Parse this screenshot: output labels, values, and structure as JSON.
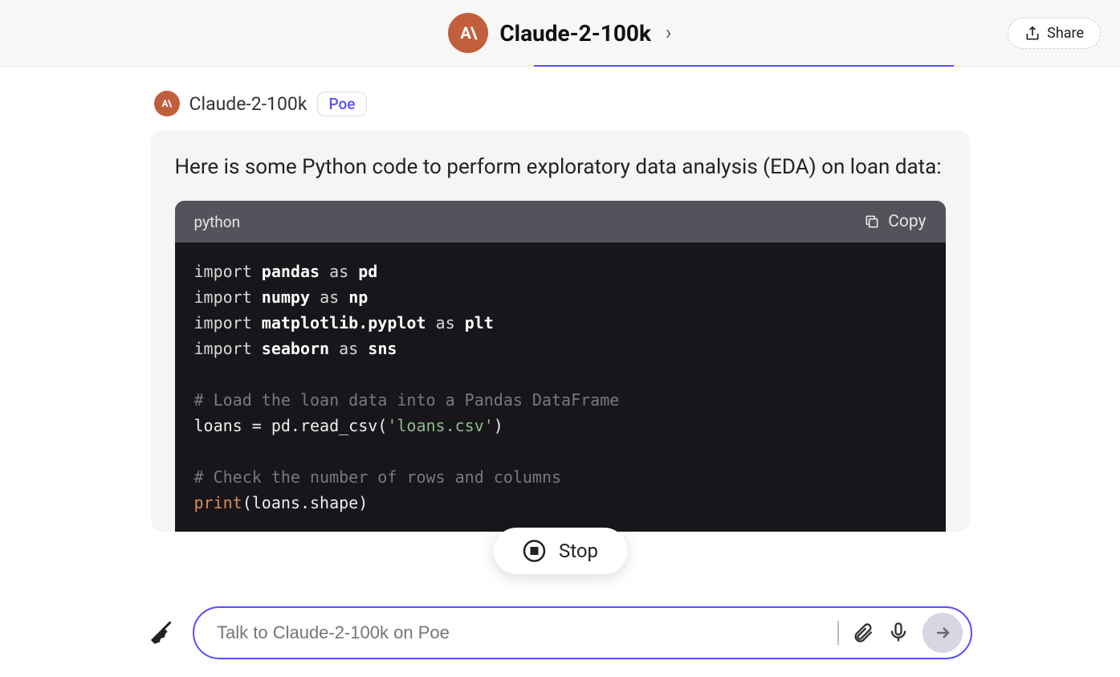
{
  "header": {
    "avatar_text": "A\\",
    "title": "Claude-2-100k",
    "share_label": "Share"
  },
  "bot": {
    "avatar_text": "A\\",
    "name": "Claude-2-100k",
    "badge": "Poe"
  },
  "message": {
    "intro": "Here is some Python code to perform exploratory data analysis (EDA) on loan data:"
  },
  "code": {
    "language": "python",
    "copy_label": "Copy",
    "lines": {
      "l1_kw1": "import",
      "l1_mod": "pandas",
      "l1_kw2": "as",
      "l1_alias": "pd",
      "l2_kw1": "import",
      "l2_mod": "numpy",
      "l2_kw2": "as",
      "l2_alias": "np",
      "l3_kw1": "import",
      "l3_mod": "matplotlib.pyplot",
      "l3_kw2": "as",
      "l3_alias": "plt",
      "l4_kw1": "import",
      "l4_mod": "seaborn",
      "l4_kw2": "as",
      "l4_alias": "sns",
      "l5_comment": "# Load the loan data into a Pandas DataFrame",
      "l6_var": "loans = pd.read_csv(",
      "l6_str": "'loans.csv'",
      "l6_end": ")",
      "l7_comment": "# Check the number of rows and columns",
      "l8_fn": "print",
      "l8_args": "(loans.shape)"
    }
  },
  "stop": {
    "label": "Stop"
  },
  "input": {
    "placeholder": "Talk to Claude-2-100k on Poe"
  }
}
